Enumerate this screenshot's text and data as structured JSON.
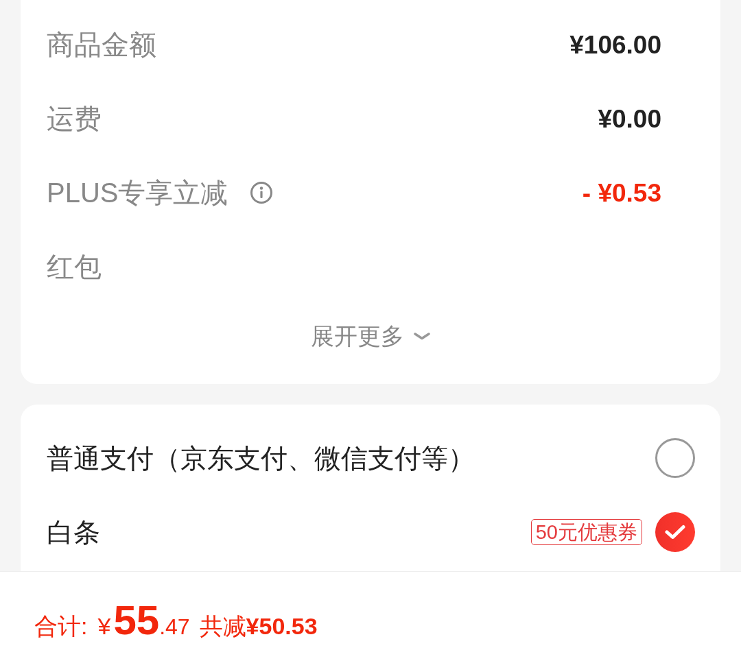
{
  "summary": {
    "rows": [
      {
        "label": "商品金额",
        "value": "¥106.00",
        "kind": "plain"
      },
      {
        "label": "运费",
        "value": "¥0.00",
        "kind": "plain"
      },
      {
        "label": "PLUS专享立减",
        "value": "- ¥0.53",
        "kind": "discount",
        "info": true
      },
      {
        "label": "红包"
      }
    ],
    "expand": "展开更多"
  },
  "payment": {
    "options": [
      {
        "label": "普通支付（京东支付、微信支付等）",
        "selected": false
      },
      {
        "label": "白条",
        "badge": "50元优惠券",
        "selected": true
      }
    ]
  },
  "total": {
    "label": "合计:",
    "price": {
      "currency": "¥",
      "integer": "55",
      "decimal": ".47"
    },
    "saved": "共减**¥50.53**"
  }
}
